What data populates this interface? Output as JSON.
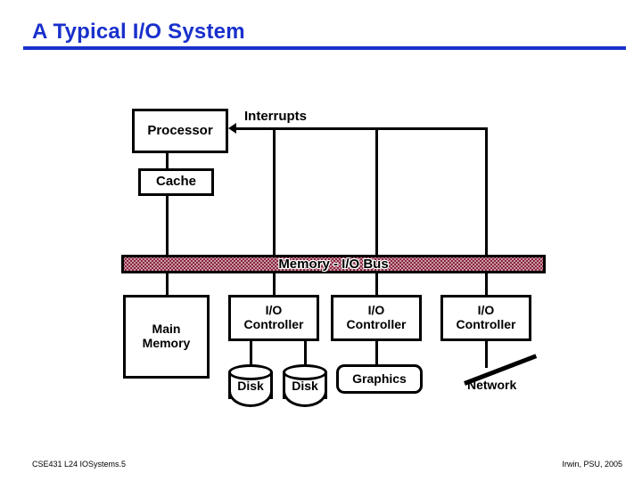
{
  "slide": {
    "title": "A Typical I/O System",
    "accent_color": "#1930CC",
    "bus": {
      "label": "Memory - I/O Bus",
      "pattern_color": "#8B2540"
    },
    "labels": {
      "interrupts": "Interrupts",
      "network": "Network"
    },
    "boxes": {
      "processor": "Processor",
      "cache": "Cache",
      "main_memory_line1": "Main",
      "main_memory_line2": "Memory",
      "io_controller_line1": "I/O",
      "io_controller_line2": "Controller",
      "graphics": "Graphics"
    },
    "disks": {
      "disk1": "Disk",
      "disk2": "Disk"
    },
    "footer": {
      "left": "CSE431  L24 IOSystems.5",
      "right": "Irwin, PSU, 2005"
    }
  }
}
